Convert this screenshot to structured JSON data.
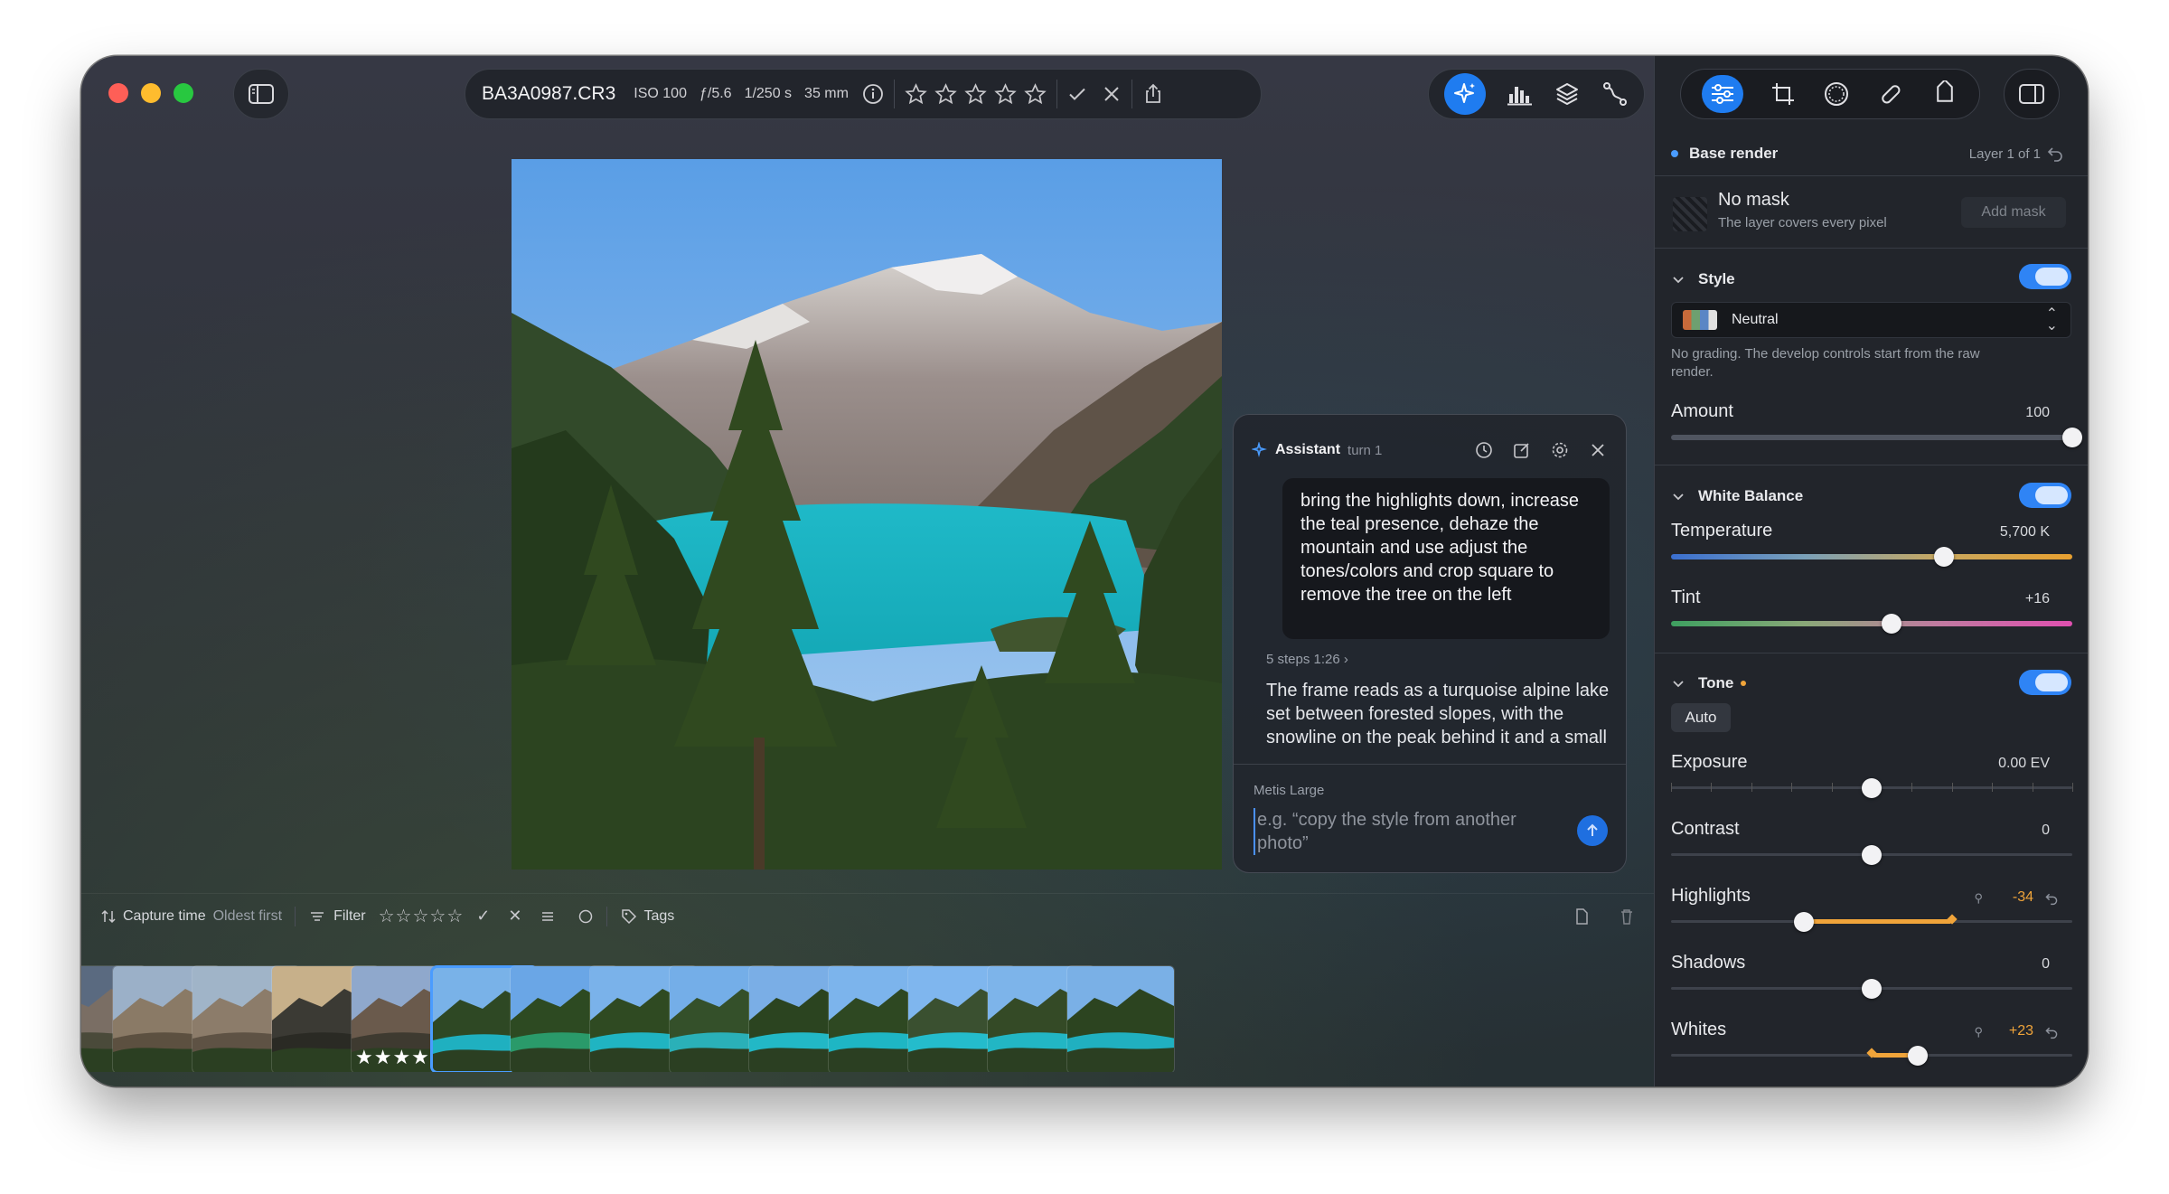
{
  "toolbar": {
    "filename": "BA3A0987.CR3",
    "iso": "ISO 100",
    "aperture": "ƒ/5.6",
    "shutter": "1/250 s",
    "focal": "35 mm",
    "rating": 0
  },
  "assistant": {
    "title": "Assistant",
    "turn": "turn 1",
    "user_message": "bring the highlights down, increase the teal presence, dehaze the mountain and use adjust the tones/colors and crop square to remove the tree on the left",
    "steps": "5 steps 1:26",
    "response": "The frame reads as a turquoise alpine lake set between forested slopes, with the snowline on the peak behind it and a small tree-clad islet in the water. The",
    "model": "Metis Large",
    "placeholder": "e.g. “copy the style from another photo”"
  },
  "filterbar": {
    "sort_label": "Capture time",
    "sort_order": "Oldest first",
    "filter_label": "Filter",
    "tags_label": "Tags"
  },
  "filmstrip": {
    "selected_index": 5,
    "five_star_index": 4,
    "stars_text": "★★★★★"
  },
  "panel": {
    "layer": {
      "name": "Base render",
      "count": "Layer 1 of 1"
    },
    "mask": {
      "title": "No mask",
      "subtitle": "The layer covers every pixel",
      "add": "Add mask"
    },
    "style": {
      "section": "Style",
      "preset": "Neutral",
      "description": "No grading. The develop controls start from the raw render.",
      "amount_label": "Amount",
      "amount_value": "100",
      "amount": 100
    },
    "white_balance": {
      "section": "White Balance",
      "temperature_label": "Temperature",
      "temperature_value": "5,700 K",
      "temperature_pos": 0.68,
      "tint_label": "Tint",
      "tint_value": "+16",
      "tint_pos": 0.55
    },
    "tone": {
      "section": "Tone",
      "auto": "Auto",
      "exposure_label": "Exposure",
      "exposure_value": "0.00 EV",
      "exposure_pos": 0.5,
      "contrast_label": "Contrast",
      "contrast_value": "0",
      "contrast_pos": 0.5,
      "highlights_label": "Highlights",
      "highlights_value": "-34",
      "highlights_pos": 0.33,
      "shadows_label": "Shadows",
      "shadows_value": "0",
      "shadows_pos": 0.5,
      "whites_label": "Whites",
      "whites_value": "+23",
      "whites_pos": 0.615
    }
  },
  "colors": {
    "accent": "#1f7cf0",
    "highlight_track": "#f0a43a"
  }
}
